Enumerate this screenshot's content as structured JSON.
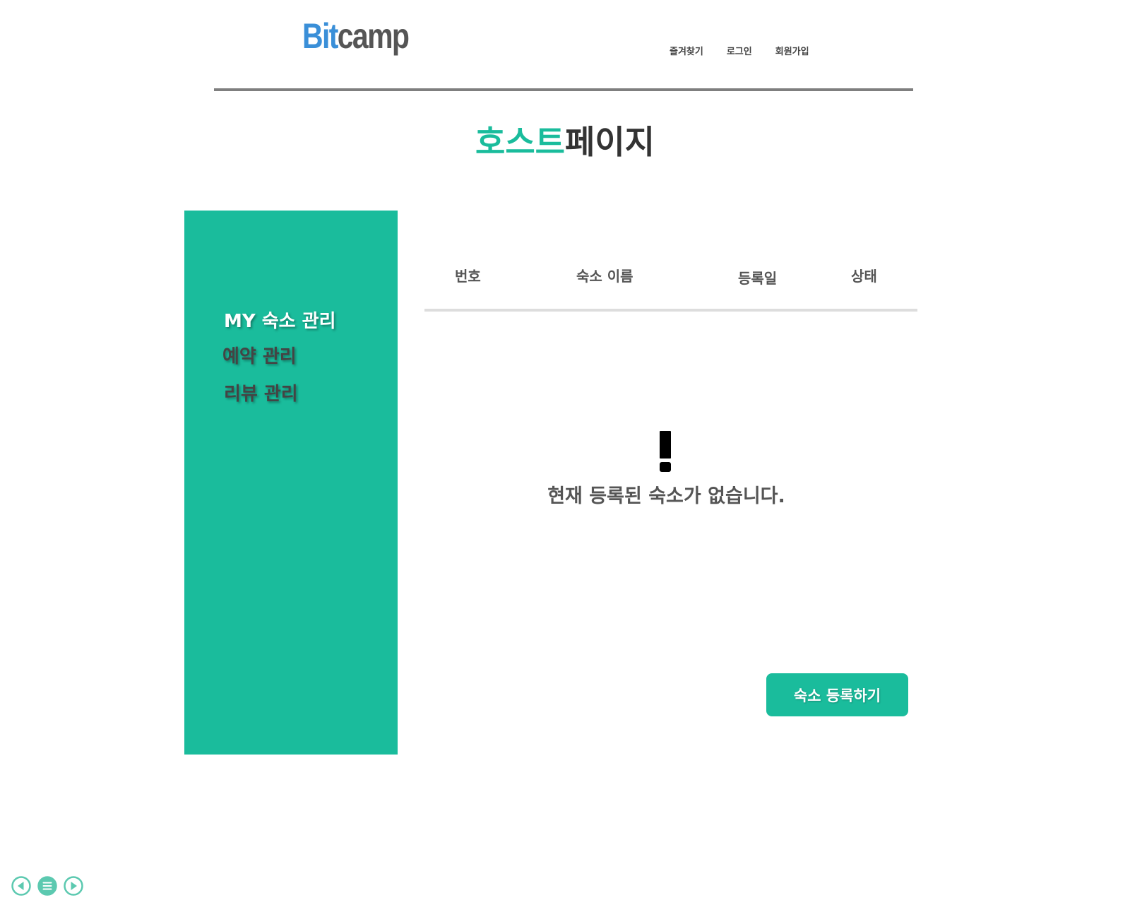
{
  "header": {
    "logo_part_a": "Bit",
    "logo_part_b": "camp",
    "nav": {
      "favorites": "즐겨찾기",
      "login": "로그인",
      "signup": "회원가입"
    }
  },
  "page_title": {
    "accent": "호스트",
    "rest": "페이지"
  },
  "sidebar": {
    "items": [
      {
        "label": "MY 숙소 관리",
        "active": true
      },
      {
        "label": "예약 관리",
        "active": false
      },
      {
        "label": "리뷰 관리",
        "active": false
      }
    ]
  },
  "table": {
    "columns": [
      "번호",
      "숙소 이름",
      "등록일",
      "상태"
    ]
  },
  "empty_state": {
    "icon": "exclamation-icon",
    "message": "현재 등록된 숙소가 없습니다."
  },
  "actions": {
    "register_label": "숙소 등록하기"
  },
  "slide_controls": {
    "icons": [
      "prev-icon",
      "menu-icon",
      "next-icon"
    ]
  },
  "colors": {
    "accent": "#1abc9c",
    "logo_blue": "#3a8fd8",
    "logo_gray": "#555555",
    "text_dark": "#444444"
  }
}
